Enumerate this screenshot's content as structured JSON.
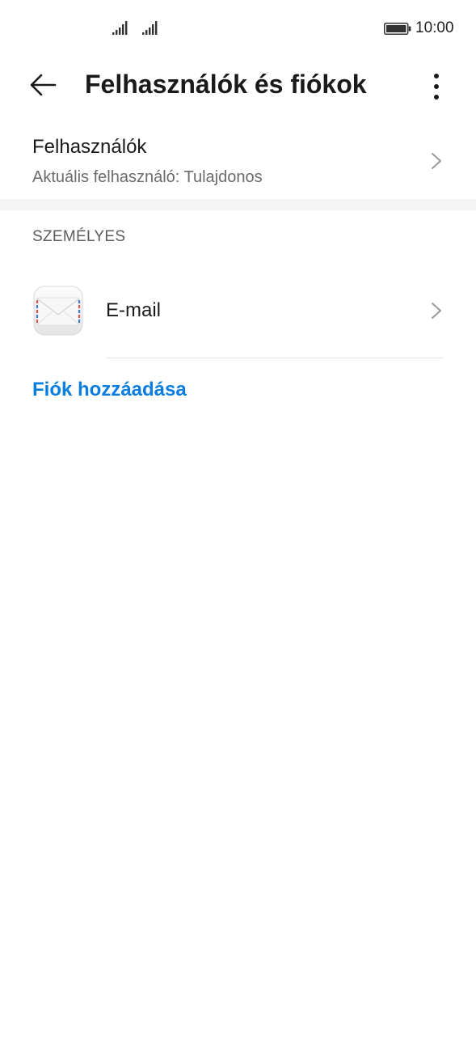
{
  "status_bar": {
    "time": "10:00",
    "signal_icons": [
      "signal-icon",
      "signal-icon"
    ],
    "battery_icon": "battery-icon"
  },
  "app_bar": {
    "title": "Felhasználók és fiókok",
    "back_icon": "arrow-left-icon",
    "more_icon": "more-vertical-icon"
  },
  "users": {
    "title": "Felhasználók",
    "subtitle": "Aktuális felhasználó: Tulajdonos"
  },
  "personal_section": {
    "header": "SZEMÉLYES",
    "items": [
      {
        "label": "E-mail",
        "icon": "mail-app-icon"
      }
    ]
  },
  "add_account": {
    "label": "Fiók hozzáadása",
    "color": "#0a7ee0"
  },
  "colors": {
    "background": "#ffffff",
    "text_primary": "#1a1a1a",
    "text_secondary": "#6b6b6b",
    "accent": "#0a7ee0",
    "divider": "#f5f5f5"
  }
}
